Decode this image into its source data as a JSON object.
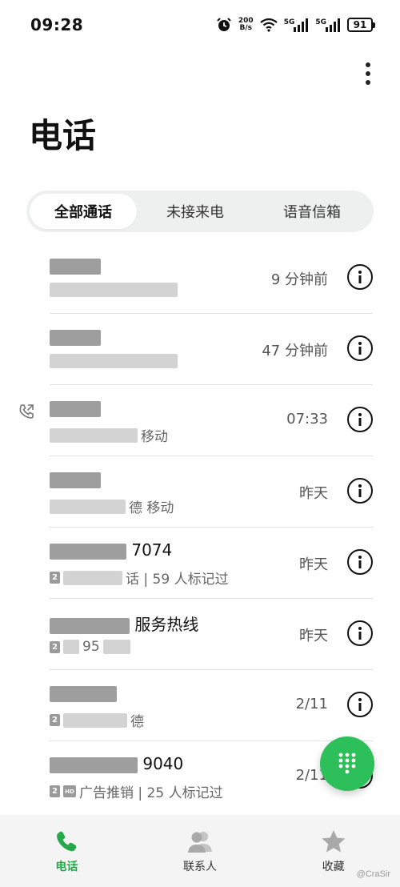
{
  "status_bar": {
    "time": "09:28",
    "net_speed_value": "200",
    "net_speed_unit": "B/s",
    "sim1_label": "5G",
    "sim2_label": "5G",
    "battery": "91"
  },
  "page": {
    "title": "电话"
  },
  "tabs": [
    {
      "label": "全部通话",
      "active": true
    },
    {
      "label": "未接来电",
      "active": false
    },
    {
      "label": "语音信箱",
      "active": false
    }
  ],
  "calls": [
    {
      "name_visible": "",
      "sub_visible": "",
      "time": "9 分钟前"
    },
    {
      "name_visible": "",
      "sub_visible": "",
      "time": "47 分钟前"
    },
    {
      "name_visible": "",
      "sub_visible": "移动",
      "time": "07:33",
      "outgoing": true
    },
    {
      "name_visible": "",
      "sub_visible": "德 移动",
      "time": "昨天"
    },
    {
      "name_visible": "7074",
      "sub_visible": "话 | 59 人标记过",
      "time": "昨天",
      "sim": "2"
    },
    {
      "name_visible": "服务热线",
      "sub_visible": "95",
      "time": "昨天",
      "sim": "2"
    },
    {
      "name_visible": "",
      "sub_visible": "德",
      "time": "2/11",
      "sim": "2"
    },
    {
      "name_visible": "9040",
      "sub_visible": "广告推销 | 25 人标记过",
      "time": "2/11",
      "sim": "2",
      "hd": "HD"
    }
  ],
  "bottom_nav": [
    {
      "label": "电话",
      "icon": "phone-icon",
      "active": true
    },
    {
      "label": "联系人",
      "icon": "contacts-icon",
      "active": false
    },
    {
      "label": "收藏",
      "icon": "star-icon",
      "active": false
    }
  ],
  "watermark": "@CraSir",
  "colors": {
    "accent": "#2dbf5a",
    "active_nav": "#24a84a",
    "tab_bg": "#eef0ef"
  }
}
